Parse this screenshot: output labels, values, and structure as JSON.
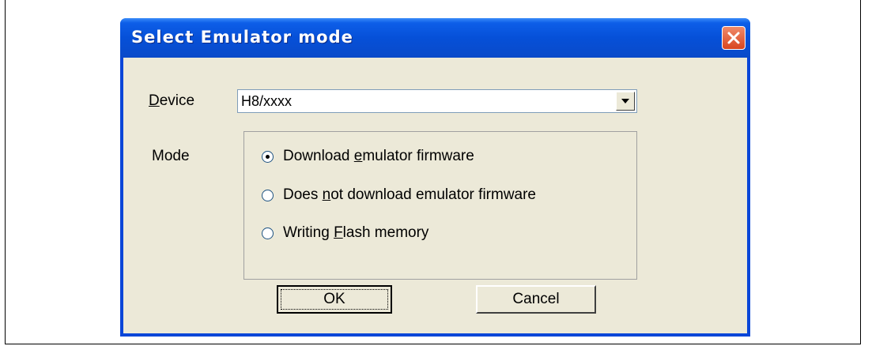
{
  "dialog": {
    "title": "Select Emulator mode",
    "device": {
      "label_accel": "D",
      "label_rest": "evice",
      "value": "H8/xxxx"
    },
    "mode": {
      "label": "Mode",
      "options": [
        {
          "pre": "Download ",
          "accel": "e",
          "post": "mulator firmware",
          "checked": true
        },
        {
          "pre": "Does ",
          "accel": "n",
          "post": "ot download emulator firmware",
          "checked": false
        },
        {
          "pre": "Writing ",
          "accel": "F",
          "post": "lash memory",
          "checked": false
        }
      ]
    },
    "buttons": {
      "ok": "OK",
      "cancel": "Cancel"
    }
  },
  "colors": {
    "titlebar": "#0650d8",
    "client": "#ece9d8",
    "close": "#d8451f"
  },
  "icons": {
    "close": "close-icon",
    "dropdown": "chevron-down-icon"
  }
}
